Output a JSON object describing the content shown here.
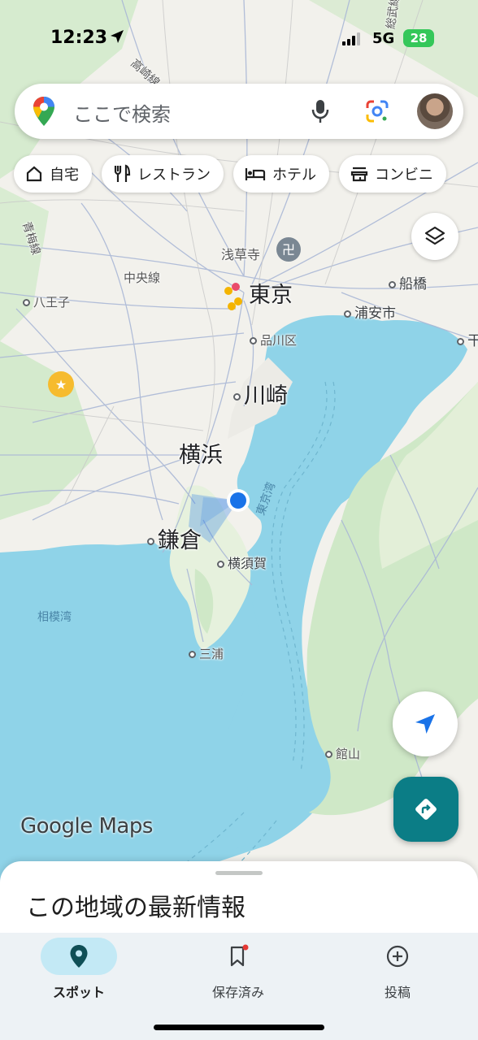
{
  "status_bar": {
    "time": "12:23",
    "network": "5G",
    "battery": "28"
  },
  "search": {
    "placeholder": "ここで検索"
  },
  "chips": [
    {
      "icon": "home-icon",
      "label": "自宅"
    },
    {
      "icon": "restaurant-icon",
      "label": "レストラン"
    },
    {
      "icon": "hotel-icon",
      "label": "ホテル"
    },
    {
      "icon": "convenience-store-icon",
      "label": "コンビニ"
    }
  ],
  "map_labels": {
    "ome_line": "青梅線",
    "takasaki_line": "高崎線",
    "sobu_line": "総武線",
    "asakusa": "浅草寺",
    "chuo_line": "中央線",
    "tokyo": "東京",
    "funabashi": "船橋",
    "hachioji": "八王子",
    "urayasu": "浦安市",
    "shinagawa": "品川区",
    "kawasaki": "川崎",
    "yokohama": "横浜",
    "kamakura": "鎌倉",
    "yokosuka": "横須賀",
    "tokyo_bay": "東京湾",
    "sagami_bay": "相模湾",
    "miura": "三浦",
    "tateyama": "館山",
    "edge_right": "干"
  },
  "branding": {
    "logo_text": "Google Maps"
  },
  "sheet": {
    "title": "この地域の最新情報"
  },
  "nav": {
    "spot": "スポット",
    "saved": "保存済み",
    "post": "投稿"
  },
  "colors": {
    "water": "#8fd3e8",
    "land": "#f3f1ec",
    "green": "#cfe8c7",
    "accent": "#0b7d86",
    "location_blue": "#1a73e8"
  }
}
